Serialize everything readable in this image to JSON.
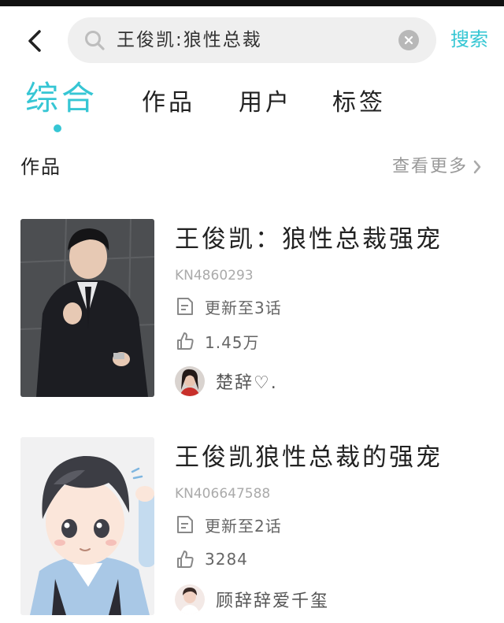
{
  "search": {
    "query": "王俊凯:狼性总裁",
    "button_label": "搜索"
  },
  "tabs": [
    {
      "label": "综合",
      "active": true
    },
    {
      "label": "作品",
      "active": false
    },
    {
      "label": "用户",
      "active": false
    },
    {
      "label": "标签",
      "active": false
    }
  ],
  "section": {
    "title": "作品",
    "see_more": "查看更多"
  },
  "results": [
    {
      "title": "王俊凯：狼性总裁强宠",
      "id": "KN4860293",
      "update": "更新至3话",
      "likes": "1.45万",
      "author": "楚辞♡."
    },
    {
      "title": "王俊凯狼性总裁的强宠",
      "id": "KN406647588",
      "update": "更新至2话",
      "likes": "3284",
      "author": "顾辞辞爱千玺"
    }
  ],
  "colors": {
    "accent": "#36c6d4",
    "muted": "#999999"
  },
  "icons": {
    "back": "chevron-left-icon",
    "search": "search-icon",
    "clear": "clear-icon",
    "see_more": "chevron-right-icon",
    "update": "document-icon",
    "likes": "thumbs-up-icon"
  }
}
